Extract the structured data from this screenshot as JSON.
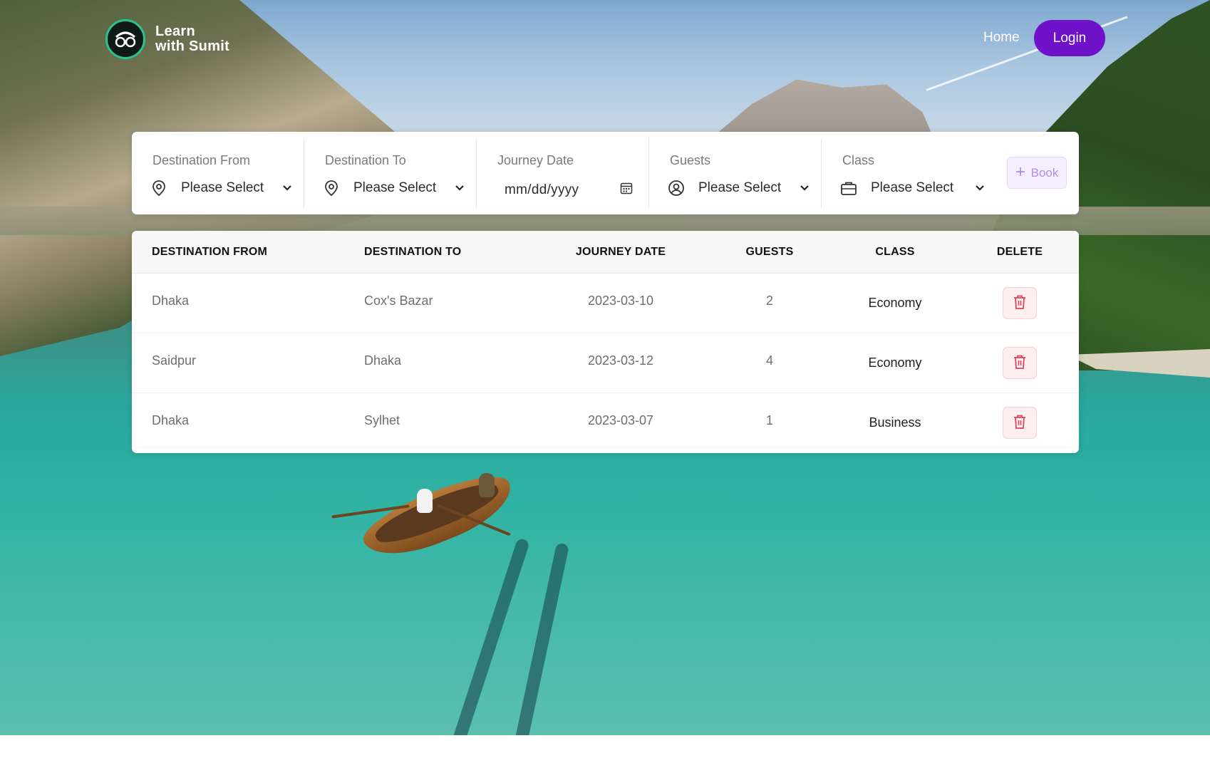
{
  "brand": {
    "line1": "Learn",
    "line2": "with Sumit"
  },
  "nav": {
    "home_label": "Home",
    "login_label": "Login"
  },
  "colors": {
    "accent": "#6d12c8",
    "logo_ring": "#29c48d",
    "delete_icon": "#e0455a",
    "book_text": "#b58be8"
  },
  "booking_form": {
    "fields": [
      {
        "label": "Destination From",
        "value": "Please Select",
        "icon": "location-pin-icon"
      },
      {
        "label": "Destination To",
        "value": "Please Select",
        "icon": "location-pin-icon"
      },
      {
        "label": "Journey Date",
        "value": "mm/dd/yyyy",
        "icon": "calendar-icon"
      },
      {
        "label": "Guests",
        "value": "Please Select",
        "icon": "user-circle-icon"
      },
      {
        "label": "Class",
        "value": "Please Select",
        "icon": "briefcase-icon"
      }
    ],
    "book_label": "Book"
  },
  "table": {
    "headers": [
      "DESTINATION FROM",
      "DESTINATION TO",
      "JOURNEY DATE",
      "GUESTS",
      "CLASS",
      "DELETE"
    ],
    "rows": [
      {
        "from": "Dhaka",
        "to": "Cox's Bazar",
        "date": "2023-03-10",
        "guests": "2",
        "class": "Economy"
      },
      {
        "from": "Saidpur",
        "to": "Dhaka",
        "date": "2023-03-12",
        "guests": "4",
        "class": "Economy"
      },
      {
        "from": "Dhaka",
        "to": "Sylhet",
        "date": "2023-03-07",
        "guests": "1",
        "class": "Business"
      }
    ]
  }
}
